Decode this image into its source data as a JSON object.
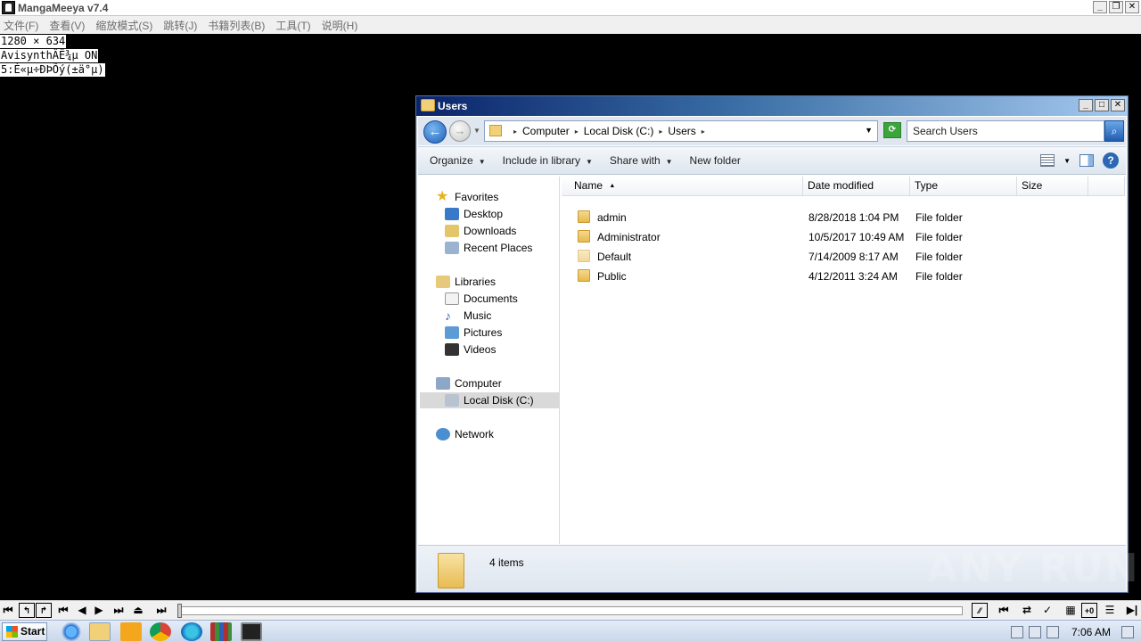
{
  "mangameeya": {
    "title": "MangaMeeya v7.4",
    "menu": [
      "文件(F)",
      "查看(V)",
      "缩放模式(S)",
      "跳转(J)",
      "书籍列表(B)",
      "工具(T)",
      "说明(H)"
    ],
    "overlay": [
      "1280 × 634",
      "AvisynthÂË¾µ ON",
      "5:É«µ÷ÐÞÕý(±ä°µ)"
    ],
    "slider_progress": 0
  },
  "explorer": {
    "title": "Users",
    "breadcrumb": [
      "Computer",
      "Local Disk (C:)",
      "Users"
    ],
    "search_placeholder": "Search Users",
    "toolbar": {
      "organize": "Organize",
      "include_in_library": "Include in library",
      "share_with": "Share with",
      "new_folder": "New folder"
    },
    "nav": {
      "favorites": "Favorites",
      "desktop": "Desktop",
      "downloads": "Downloads",
      "recent_places": "Recent Places",
      "libraries": "Libraries",
      "documents": "Documents",
      "music": "Music",
      "pictures": "Pictures",
      "videos": "Videos",
      "computer": "Computer",
      "local_disk": "Local Disk (C:)",
      "network": "Network"
    },
    "columns": [
      "Name",
      "Date modified",
      "Type",
      "Size"
    ],
    "files": [
      {
        "name": "admin",
        "date": "8/28/2018 1:04 PM",
        "type": "File folder"
      },
      {
        "name": "Administrator",
        "date": "10/5/2017 10:49 AM",
        "type": "File folder"
      },
      {
        "name": "Default",
        "date": "7/14/2009 8:17 AM",
        "type": "File folder"
      },
      {
        "name": "Public",
        "date": "4/12/2011 3:24 AM",
        "type": "File folder"
      }
    ],
    "status": "4 items"
  },
  "taskbar": {
    "start": "Start",
    "clock": "7:06 AM"
  },
  "watermark": "ANY RUN"
}
